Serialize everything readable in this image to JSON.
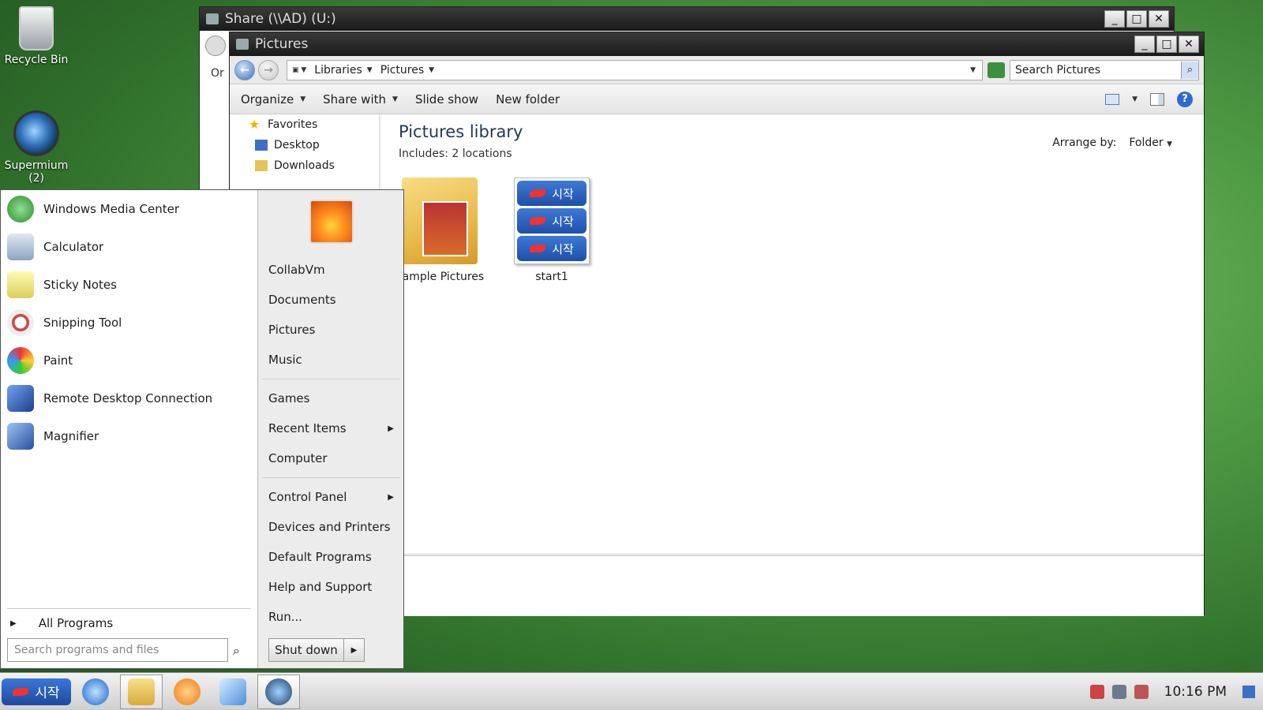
{
  "desktop": {
    "icons": [
      {
        "label": "Recycle Bin"
      },
      {
        "label": "Supermium",
        "badge": "(2)"
      }
    ]
  },
  "share_window": {
    "title": "Share (\\\\AD) (U:)",
    "org_label": "Or"
  },
  "pictures_window": {
    "title": "Pictures",
    "breadcrumbs": [
      "Libraries",
      "Pictures"
    ],
    "search_placeholder": "Search Pictures",
    "commands": {
      "organize": "Organize",
      "share_with": "Share with",
      "slide_show": "Slide show",
      "new_folder": "New folder"
    },
    "nav": {
      "favorites": "Favorites",
      "items": [
        "Desktop",
        "Downloads"
      ]
    },
    "library": {
      "title": "Pictures library",
      "subtitle": "Includes:  2 locations",
      "arrange_label": "Arrange by:",
      "arrange_value": "Folder"
    },
    "files": [
      {
        "name": "Sample Pictures",
        "type": "folder"
      },
      {
        "name": "start1",
        "type": "image",
        "chip_text": "시작"
      }
    ]
  },
  "start_menu": {
    "programs": [
      {
        "label": "Windows Media Center",
        "color": "#3a9a3a"
      },
      {
        "label": "Calculator",
        "color": "#9ab0c8"
      },
      {
        "label": "Sticky Notes",
        "color": "#e8e07a"
      },
      {
        "label": "Snipping Tool",
        "color": "#d14848"
      },
      {
        "label": "Paint",
        "color": "#e0a84a"
      },
      {
        "label": "Remote Desktop Connection",
        "color": "#2a5fb0"
      },
      {
        "label": "Magnifier",
        "color": "#4a78c8"
      }
    ],
    "all_programs": "All Programs",
    "search_placeholder": "Search programs and files",
    "right_links": {
      "group1": [
        "CollabVm",
        "Documents",
        "Pictures",
        "Music"
      ],
      "group2": [
        "Games",
        "Recent Items",
        "Computer"
      ],
      "group3": [
        "Control Panel",
        "Devices and Printers",
        "Default Programs",
        "Help and Support",
        "Run..."
      ]
    },
    "shutdown": "Shut down"
  },
  "taskbar": {
    "start_label": "시작",
    "clock": "10:16 PM"
  }
}
